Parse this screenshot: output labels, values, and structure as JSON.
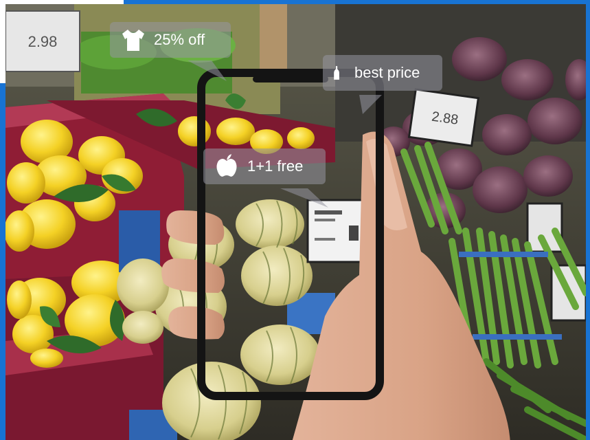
{
  "overlay_tags": [
    {
      "label": "25% off",
      "icon": "tshirt-icon"
    },
    {
      "label": "best price",
      "icon": "bottle-icon"
    },
    {
      "label": "1+1 free",
      "icon": "apple-icon"
    }
  ],
  "price_cards": [
    {
      "text": "2.98"
    },
    {
      "text": "2.88"
    }
  ],
  "accent_color": "#1873d3"
}
